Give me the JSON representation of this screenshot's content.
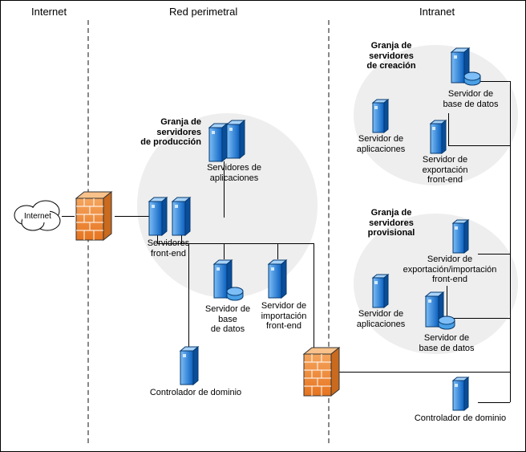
{
  "zones": {
    "internet": "Internet",
    "perimeter": "Red perimetral",
    "intranet": "Intranet"
  },
  "cloud_label": "Internet",
  "farms": {
    "production": {
      "title": "Granja de\nservidores\nde producción",
      "app_servers": "Servidores de\naplicaciones",
      "front_end": "Servidores\nfront-end",
      "db_server": "Servidor de\nbase\nde datos",
      "import_server": "Servidor de\nimportación\nfront-end"
    },
    "creation": {
      "title": "Granja de\nservidores\nde creación",
      "db_server": "Servidor de\nbase de datos",
      "app_server": "Servidor de\naplicaciones",
      "export_server": "Servidor de\nexportación\nfront-end"
    },
    "provisional": {
      "title": "Granja de\nservidores\nprovisional",
      "expimp_server": "Servidor de\nexportación/importación\nfront-end",
      "app_server": "Servidor de\naplicaciones",
      "db_server": "Servidor de\nbase de datos"
    }
  },
  "domain_controller": "Controlador de dominio",
  "colors": {
    "server_blue_light": "#5aa9f2",
    "server_blue_dark": "#0a5fbf",
    "firewall_orange": "#f08b3a",
    "firewall_dark": "#b85a18",
    "disk": "#2d89d6"
  }
}
